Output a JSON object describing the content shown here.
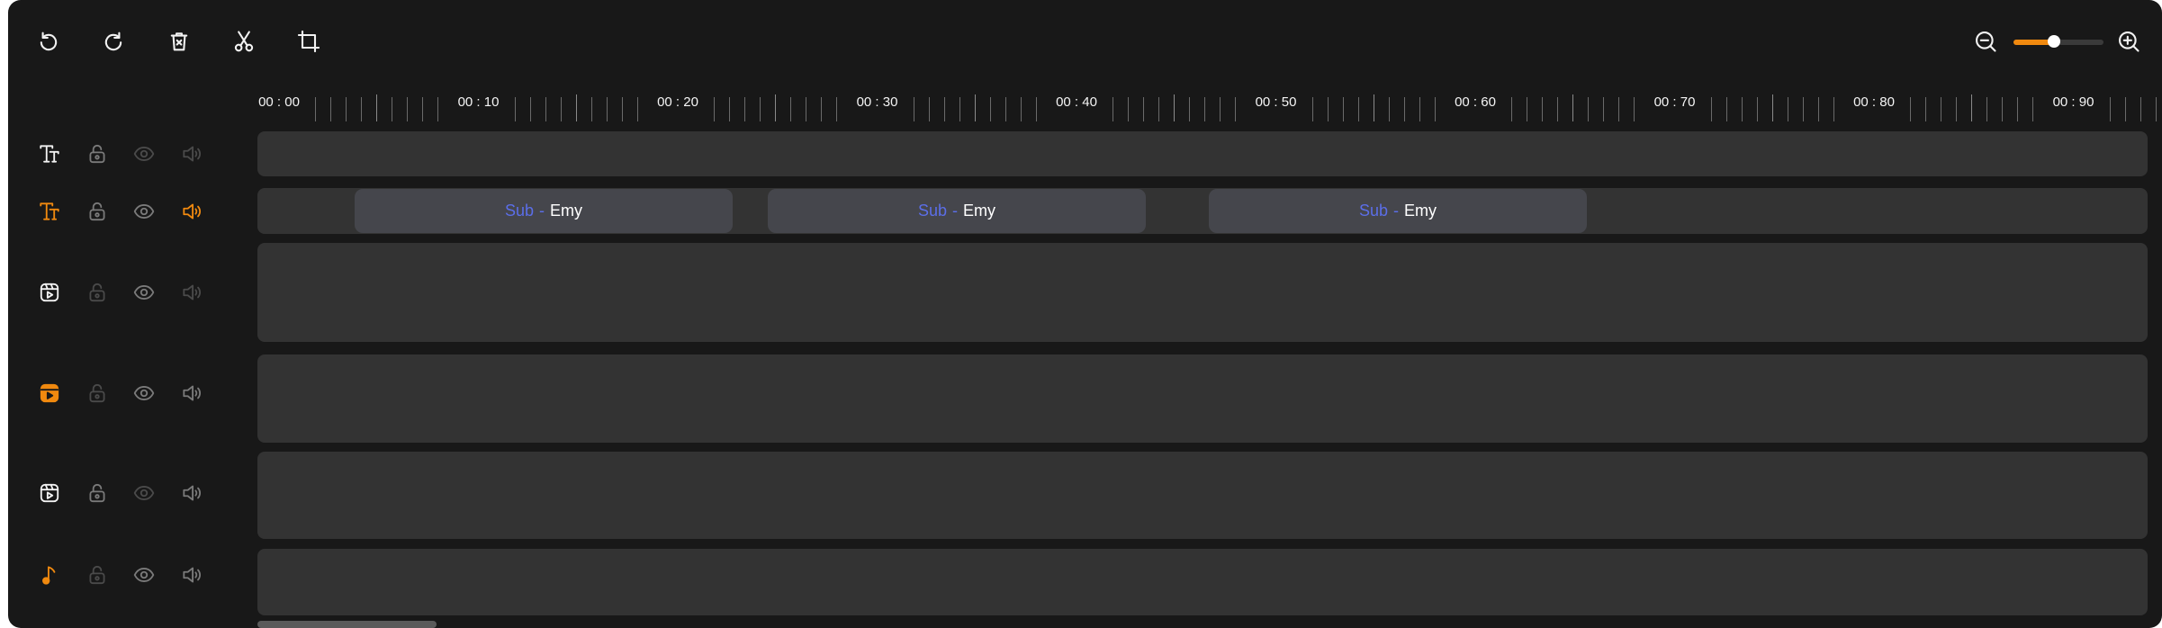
{
  "colors": {
    "accent": "#f0890f",
    "clip_sub": "#5b6ee8",
    "icon_active": "#f2f2f2",
    "icon_muted": "#4a4a4a",
    "icon_dim": "#7a7a7a"
  },
  "toolbar": {
    "left_tools": [
      {
        "name": "undo-icon"
      },
      {
        "name": "redo-icon"
      },
      {
        "name": "delete-icon"
      },
      {
        "name": "cut-icon"
      },
      {
        "name": "crop-icon"
      }
    ],
    "zoom": {
      "out_icon": "zoom-out-icon",
      "in_icon": "zoom-in-icon",
      "level": 0.45
    }
  },
  "ruler": {
    "labels": [
      "00 : 00",
      "00 : 10",
      "00 : 20",
      "00 : 30",
      "00 : 40",
      "00 : 50",
      "00 : 60",
      "00 : 70",
      "00 : 80",
      "00 : 90"
    ]
  },
  "tracks": [
    {
      "type_icon": "text-icon",
      "type_color": "active",
      "lock": "dim",
      "eye": "muted",
      "sound": "muted"
    },
    {
      "type_icon": "text-icon",
      "type_color": "accent",
      "lock": "dim",
      "eye": "dim",
      "sound": "accent"
    },
    {
      "type_icon": "video-reel-icon",
      "type_color": "active",
      "lock": "muted",
      "eye": "dim",
      "sound": "muted"
    },
    {
      "type_icon": "video-reel-icon",
      "type_color": "accent",
      "lock": "muted",
      "eye": "dim",
      "sound": "dim"
    },
    {
      "type_icon": "video-reel-icon",
      "type_color": "active",
      "lock": "dim",
      "eye": "muted",
      "sound": "dim"
    },
    {
      "type_icon": "music-note-icon",
      "type_color": "accent",
      "lock": "muted",
      "eye": "dim",
      "sound": "dim"
    }
  ],
  "clips": [
    {
      "sub": "Sub",
      "sep": "-",
      "name": "Emy"
    },
    {
      "sub": "Sub",
      "sep": "-",
      "name": "Emy"
    },
    {
      "sub": "Sub",
      "sep": "-",
      "name": "Emy"
    }
  ]
}
